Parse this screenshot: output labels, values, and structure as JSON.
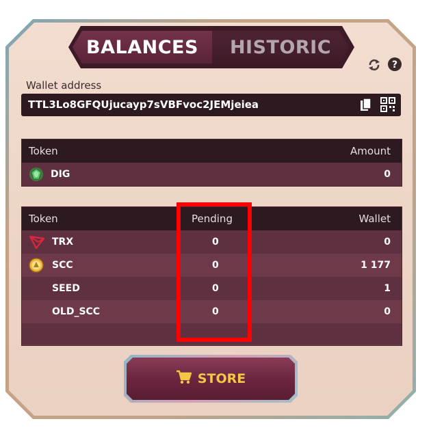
{
  "tabs": {
    "balances": "BALANCES",
    "historic": "HISTORIC"
  },
  "wallet": {
    "label": "Wallet address",
    "address": "TTL3Lo8GFQUjucayp7sVBFvoc2JEMjeiea"
  },
  "tokens_table": {
    "headers": {
      "token": "Token",
      "amount": "Amount"
    },
    "rows": [
      {
        "name": "DIG",
        "amount": "0",
        "icon": "dig-gem-icon"
      }
    ]
  },
  "wallet_table": {
    "headers": {
      "token": "Token",
      "pending": "Pending",
      "wallet": "Wallet"
    },
    "rows": [
      {
        "name": "TRX",
        "pending": "0",
        "wallet": "0",
        "icon": "trx-icon"
      },
      {
        "name": "SCC",
        "pending": "0",
        "wallet": "1 177",
        "icon": "scc-coin-icon"
      },
      {
        "name": "SEED",
        "pending": "0",
        "wallet": "1",
        "icon": ""
      },
      {
        "name": "OLD_SCC",
        "pending": "0",
        "wallet": "0",
        "icon": ""
      }
    ]
  },
  "store": {
    "label": "STORE",
    "icon": "cart-icon"
  },
  "colors": {
    "highlight": "#ff0000",
    "accent": "#f3c845",
    "panel": "#eed6c7",
    "row": "#6e3a4a"
  }
}
